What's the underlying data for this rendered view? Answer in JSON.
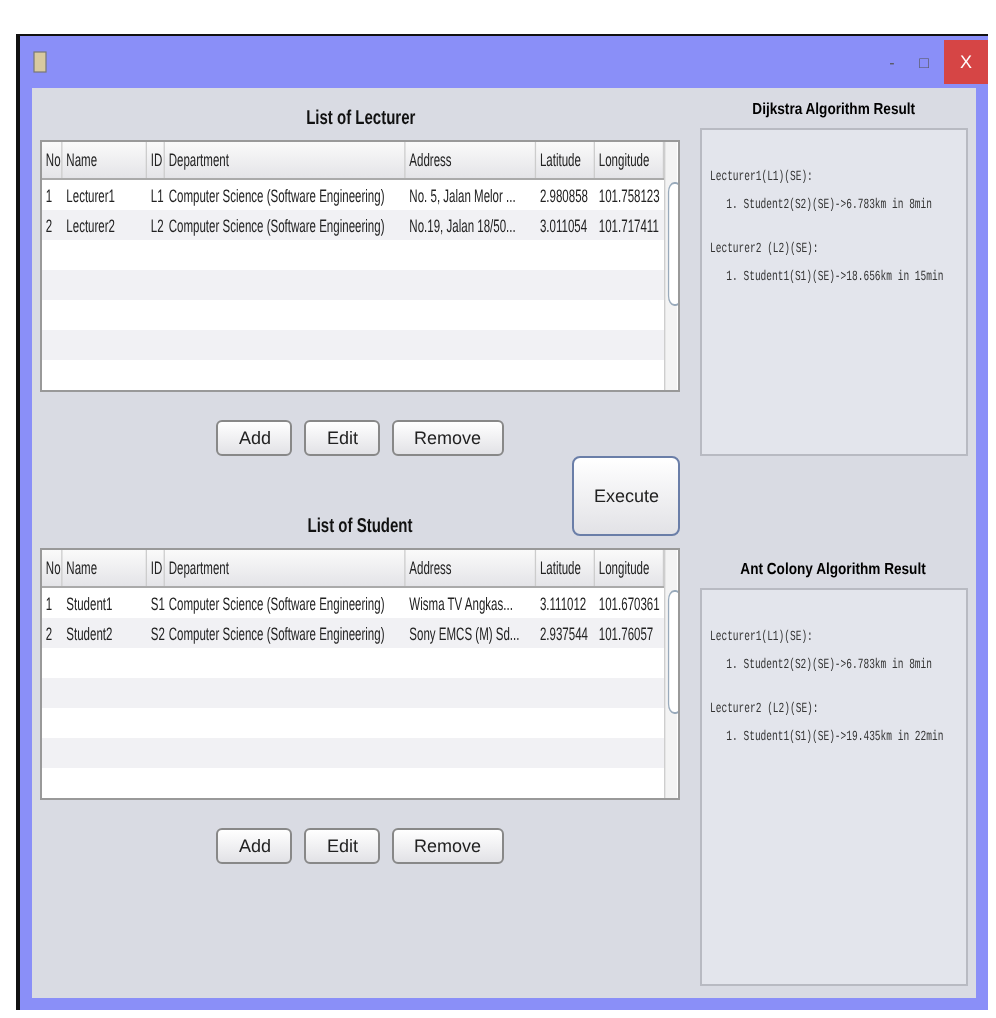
{
  "window": {
    "title_controls": [
      "-",
      "□",
      "X"
    ]
  },
  "lecturers": {
    "title": "List of Lecturer",
    "columns": [
      "No",
      "Name",
      "ID",
      "Department",
      "Address",
      "Latitude",
      "Longitude"
    ],
    "rows": [
      [
        "1",
        "Lecturer1",
        "L1",
        "Computer Science (Software Engineering)",
        "No. 5, Jalan Melor ...",
        "2.980858",
        "101.758123"
      ],
      [
        "2",
        "Lecturer2",
        "L2",
        "Computer Science (Software Engineering)",
        "No.19, Jalan 18/50...",
        "3.011054",
        "101.717411"
      ]
    ],
    "buttons": [
      "Add",
      "Edit",
      "Remove"
    ]
  },
  "execute_button": "Execute",
  "students": {
    "title": "List of Student",
    "columns": [
      "No",
      "Name",
      "ID",
      "Department",
      "Address",
      "Latitude",
      "Longitude"
    ],
    "rows": [
      [
        "1",
        "Student1",
        "S1",
        "Computer Science (Software Engineering)",
        "Wisma TV Angkas...",
        "3.111012",
        "101.670361"
      ],
      [
        "2",
        "Student2",
        "S2",
        "Computer Science (Software Engineering)",
        "Sony EMCS (M) Sd...",
        "2.937544",
        "101.76057"
      ]
    ],
    "buttons": [
      "Add",
      "Edit",
      "Remove"
    ]
  },
  "results": [
    {
      "title": "Dijkstra Algorithm Result",
      "lines": [
        {
          "kind": "heading",
          "text": "Lecturer1(L1)(SE):"
        },
        {
          "kind": "item",
          "text": "1. Student2(S2)(SE)->6.783km in 8min"
        },
        {
          "kind": "heading",
          "text": "Lecturer2 (L2)(SE):"
        },
        {
          "kind": "item",
          "text": "1. Student1(S1)(SE)->18.656km in 15min"
        }
      ]
    },
    {
      "title": "Ant Colony Algorithm Result",
      "lines": [
        {
          "kind": "heading",
          "text": "Lecturer1(L1)(SE):"
        },
        {
          "kind": "item",
          "text": "1. Student2(S2)(SE)->6.783km in 8min"
        },
        {
          "kind": "heading",
          "text": "Lecturer2 (L2)(SE):"
        },
        {
          "kind": "item",
          "text": "1. Student1(S1)(SE)->19.435km in 22min"
        }
      ]
    }
  ]
}
